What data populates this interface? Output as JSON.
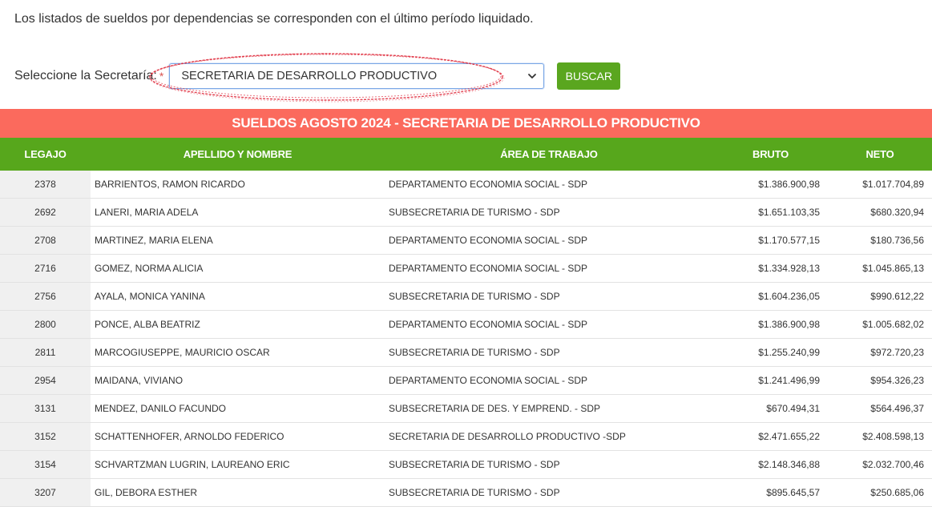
{
  "intro_text": "Los listados de sueldos por dependencias se corresponden con el último período liquidado.",
  "form": {
    "label": "Seleccione la Secretaría:",
    "required_mark": "*",
    "selected_value": "SECRETARIA DE DESARROLLO PRODUCTIVO",
    "button_label": "BUSCAR"
  },
  "colors": {
    "title_bar": "#fb6a5d",
    "header_bar": "#57a71c",
    "button": "#5aa61f",
    "highlight_ellipse": "#e03040"
  },
  "table": {
    "title": "SUELDOS AGOSTO 2024 - SECRETARIA DE DESARROLLO PRODUCTIVO",
    "headers": {
      "legajo": "LEGAJO",
      "nombre": "APELLIDO Y NOMBRE",
      "area": "ÁREA DE TRABAJO",
      "bruto": "BRUTO",
      "neto": "NETO"
    },
    "rows": [
      {
        "legajo": "2378",
        "nombre": "BARRIENTOS, RAMON RICARDO",
        "area": "DEPARTAMENTO ECONOMIA SOCIAL - SDP",
        "bruto": "$1.386.900,98",
        "neto": "$1.017.704,89"
      },
      {
        "legajo": "2692",
        "nombre": "LANERI, MARIA ADELA",
        "area": "SUBSECRETARIA DE TURISMO - SDP",
        "bruto": "$1.651.103,35",
        "neto": "$680.320,94"
      },
      {
        "legajo": "2708",
        "nombre": "MARTINEZ, MARIA ELENA",
        "area": "DEPARTAMENTO ECONOMIA SOCIAL - SDP",
        "bruto": "$1.170.577,15",
        "neto": "$180.736,56"
      },
      {
        "legajo": "2716",
        "nombre": "GOMEZ, NORMA ALICIA",
        "area": "DEPARTAMENTO ECONOMIA SOCIAL - SDP",
        "bruto": "$1.334.928,13",
        "neto": "$1.045.865,13"
      },
      {
        "legajo": "2756",
        "nombre": "AYALA, MONICA YANINA",
        "area": "SUBSECRETARIA DE TURISMO - SDP",
        "bruto": "$1.604.236,05",
        "neto": "$990.612,22"
      },
      {
        "legajo": "2800",
        "nombre": "PONCE, ALBA BEATRIZ",
        "area": "DEPARTAMENTO ECONOMIA SOCIAL - SDP",
        "bruto": "$1.386.900,98",
        "neto": "$1.005.682,02"
      },
      {
        "legajo": "2811",
        "nombre": "MARCOGIUSEPPE, MAURICIO OSCAR",
        "area": "SUBSECRETARIA DE TURISMO - SDP",
        "bruto": "$1.255.240,99",
        "neto": "$972.720,23"
      },
      {
        "legajo": "2954",
        "nombre": "MAIDANA, VIVIANO",
        "area": "DEPARTAMENTO ECONOMIA SOCIAL - SDP",
        "bruto": "$1.241.496,99",
        "neto": "$954.326,23"
      },
      {
        "legajo": "3131",
        "nombre": "MENDEZ, DANILO FACUNDO",
        "area": "SUBSECRETARIA DE DES. Y EMPREND. - SDP",
        "bruto": "$670.494,31",
        "neto": "$564.496,37"
      },
      {
        "legajo": "3152",
        "nombre": "SCHATTENHOFER, ARNOLDO FEDERICO",
        "area": "SECRETARIA DE DESARROLLO PRODUCTIVO -SDP",
        "bruto": "$2.471.655,22",
        "neto": "$2.408.598,13"
      },
      {
        "legajo": "3154",
        "nombre": "SCHVARTZMAN LUGRIN, LAUREANO ERIC",
        "area": "SUBSECRETARIA DE TURISMO - SDP",
        "bruto": "$2.148.346,88",
        "neto": "$2.032.700,46"
      },
      {
        "legajo": "3207",
        "nombre": "GIL, DEBORA ESTHER",
        "area": "SUBSECRETARIA DE TURISMO - SDP",
        "bruto": "$895.645,57",
        "neto": "$250.685,06"
      }
    ]
  }
}
